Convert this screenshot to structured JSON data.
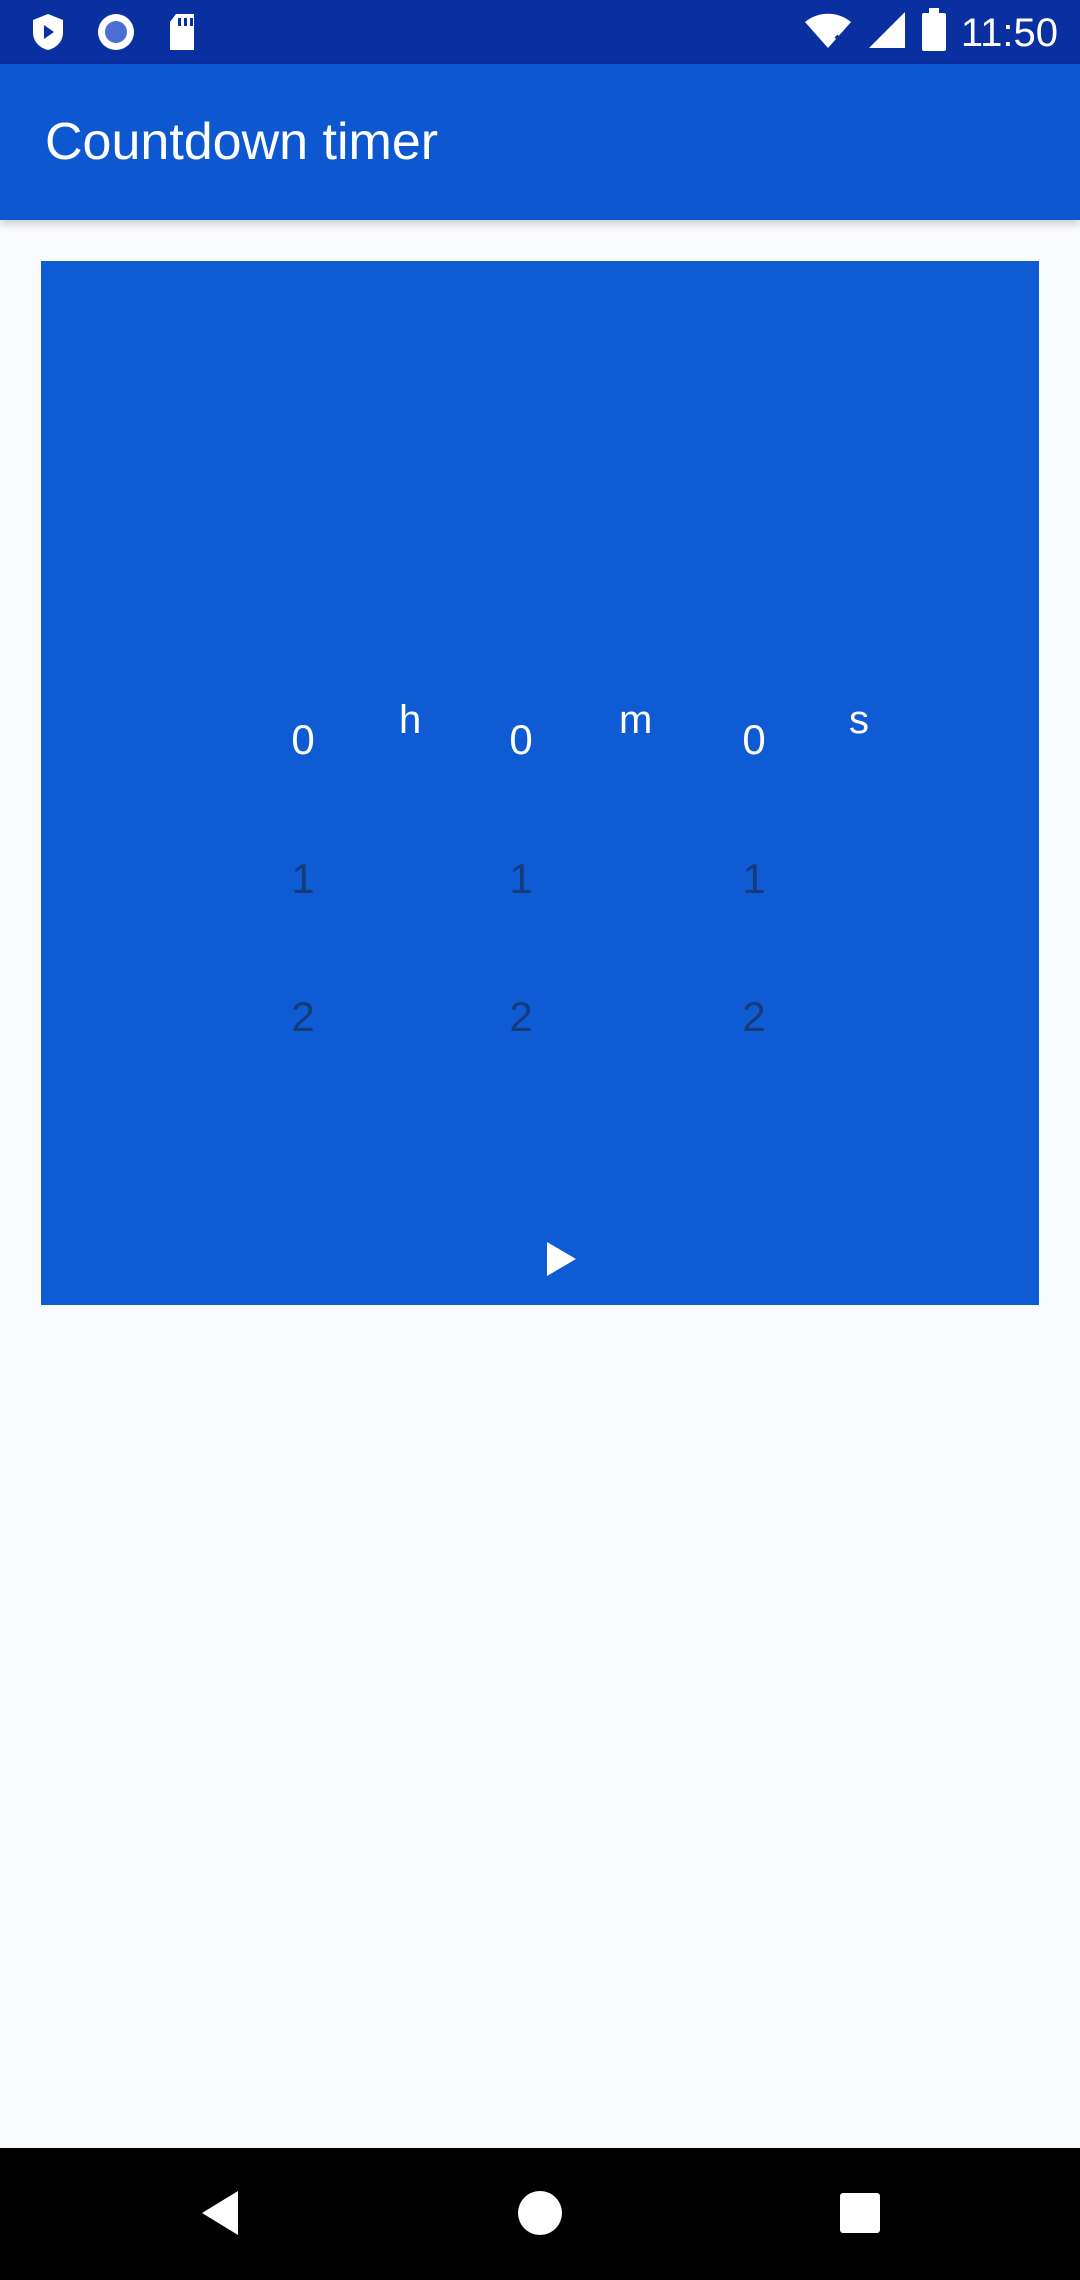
{
  "status_bar": {
    "time": "11:50",
    "icons": [
      "shield-icon",
      "circle-record-icon",
      "sd-card-icon",
      "wifi-icon",
      "signal-icon",
      "battery-icon"
    ]
  },
  "app_bar": {
    "title": "Countdown timer"
  },
  "timer": {
    "hours": {
      "selected": "0",
      "next": [
        "1",
        "2"
      ],
      "unit": "h"
    },
    "minutes": {
      "selected": "0",
      "next": [
        "1",
        "2"
      ],
      "unit": "m"
    },
    "seconds": {
      "selected": "0",
      "next": [
        "1",
        "2"
      ],
      "unit": "s"
    },
    "play_icon": "play-icon"
  },
  "nav_bar": {
    "buttons": [
      "back-icon",
      "home-icon",
      "recents-icon"
    ]
  },
  "colors": {
    "status_bar": "#0a2fa0",
    "app_bar": "#0d58d1",
    "card": "#0f5bd3",
    "background": "#fafbff"
  }
}
